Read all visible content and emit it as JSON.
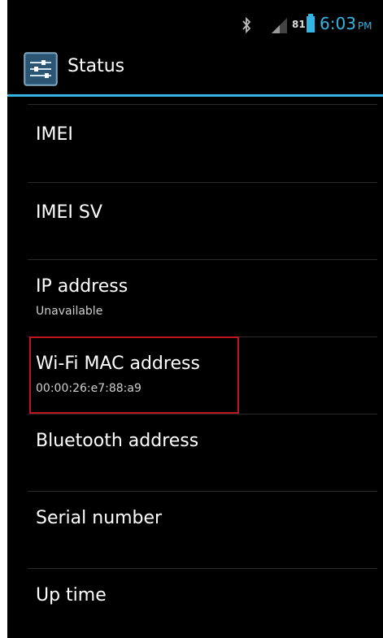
{
  "status_bar": {
    "battery_level": "81",
    "time": "6:03",
    "time_suffix": "PM",
    "accent_color": "#33b5e5"
  },
  "action_bar": {
    "title": "Status",
    "icon": "settings-sliders-icon"
  },
  "items": [
    {
      "title": "IMEI",
      "summary": ""
    },
    {
      "title": "IMEI SV",
      "summary": ""
    },
    {
      "title": "IP address",
      "summary": "Unavailable"
    },
    {
      "title": "Wi-Fi MAC address",
      "summary": "00:00:26:e7:88:a9"
    },
    {
      "title": "Bluetooth address",
      "summary": ""
    },
    {
      "title": "Serial number",
      "summary": ""
    },
    {
      "title": "Up time",
      "summary": ""
    }
  ],
  "highlight_color": "#c0141e"
}
